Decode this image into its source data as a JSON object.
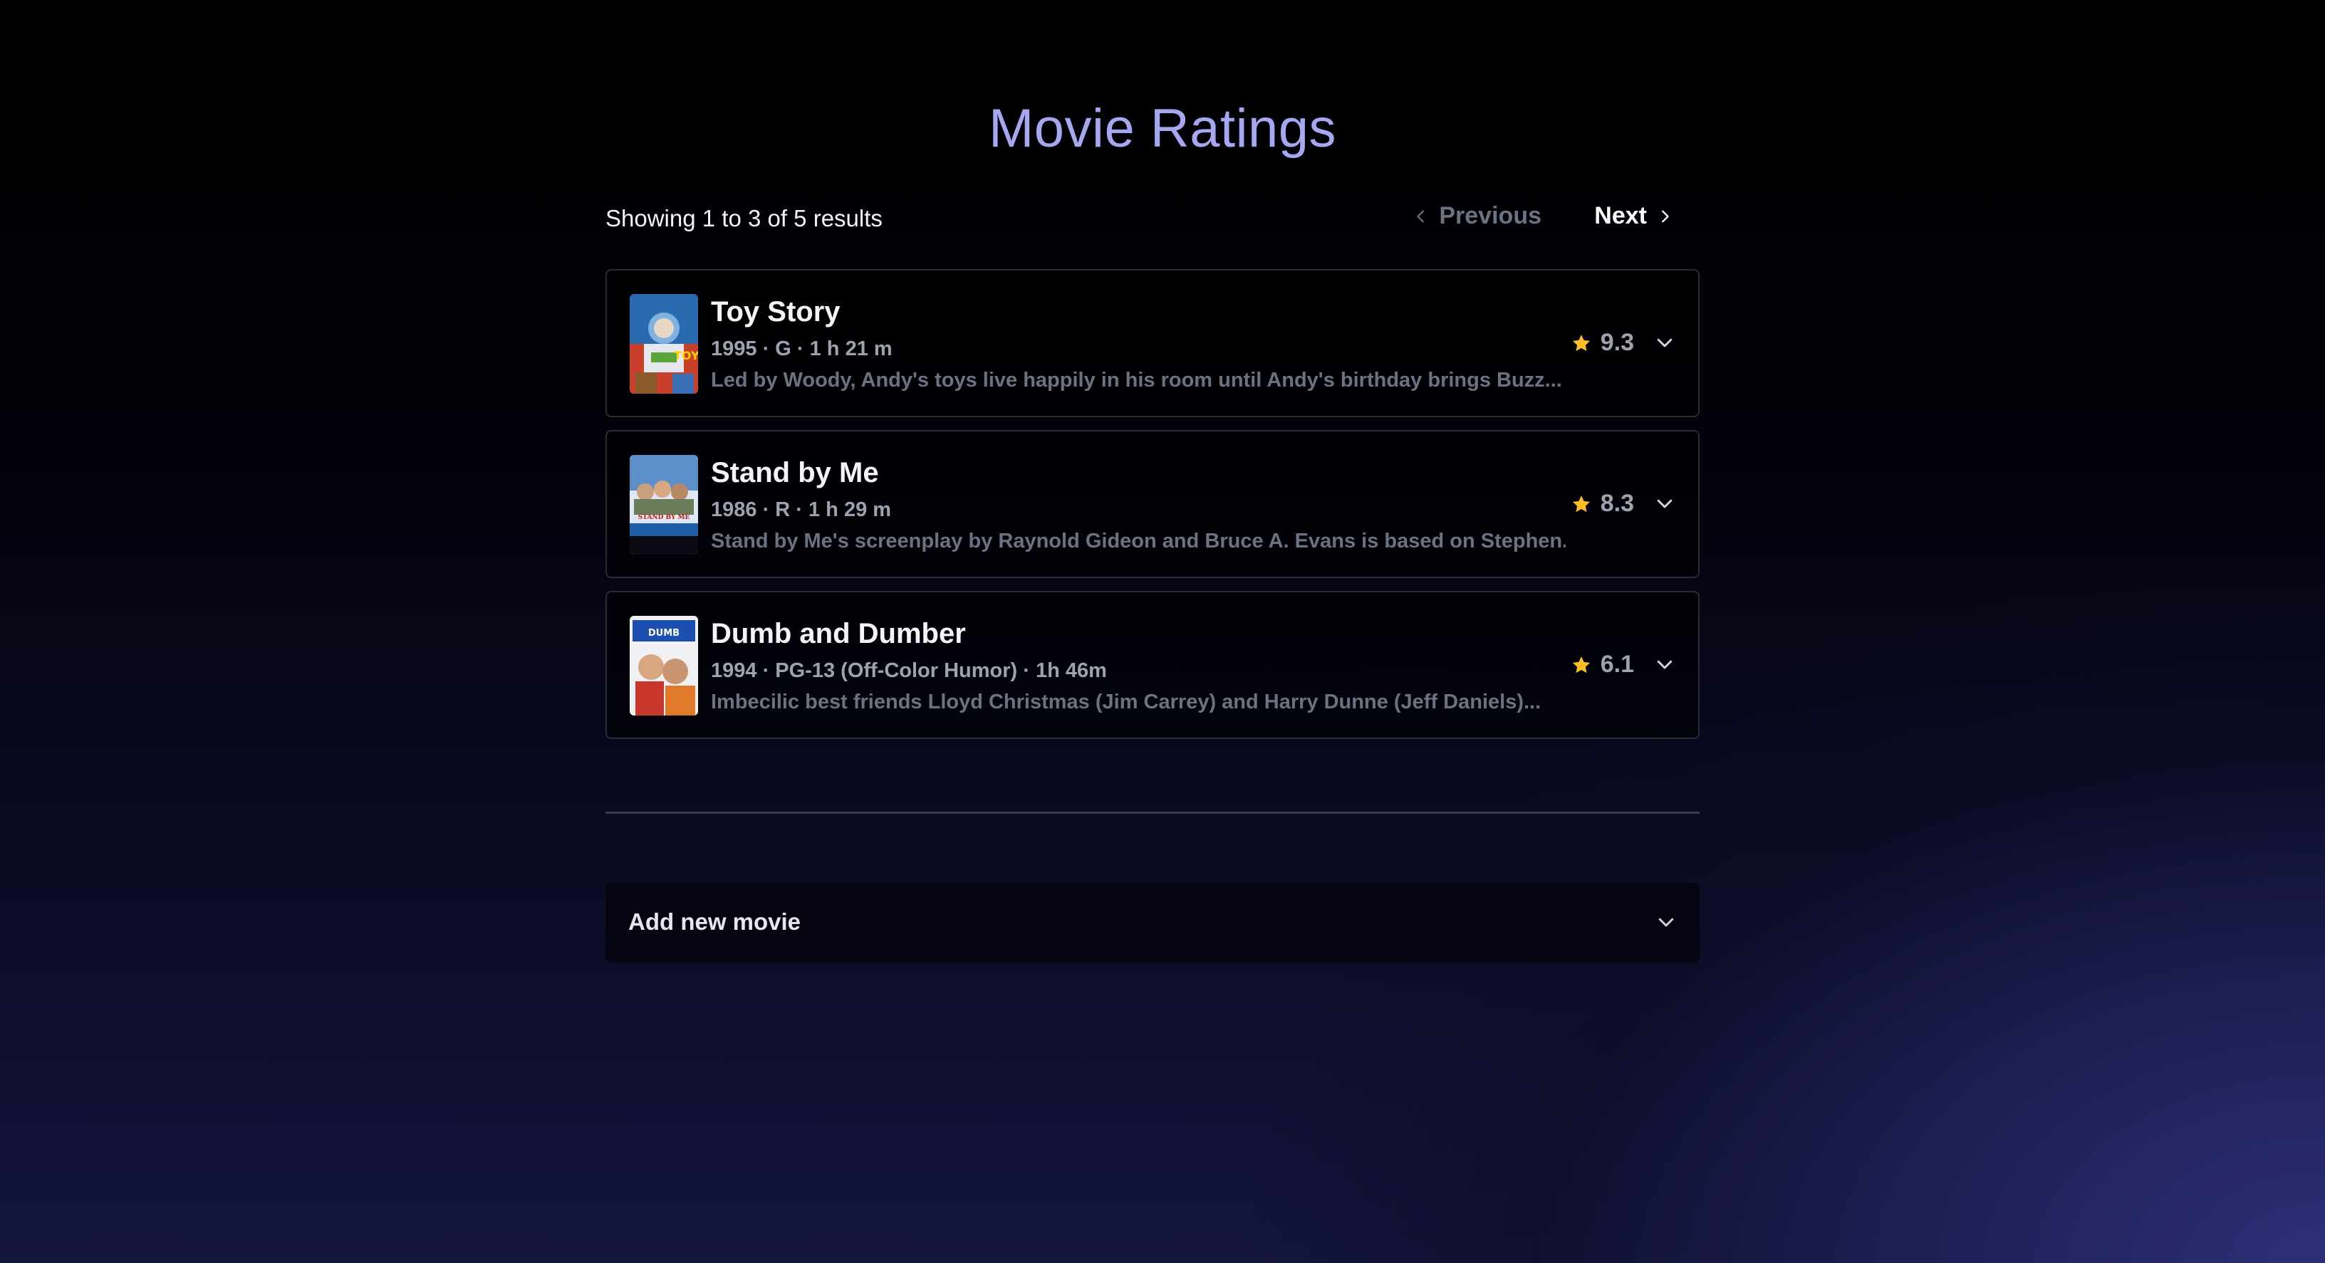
{
  "page": {
    "title": "Movie Ratings"
  },
  "toolbar": {
    "result_count": "Showing 1 to 3 of 5 results",
    "prev_label": "Previous",
    "next_label": "Next",
    "prev_icon": "chevron-left-icon",
    "next_icon": "chevron-right-icon"
  },
  "movies": [
    {
      "title": "Toy Story",
      "meta": "1995 · G · 1 h 21 m",
      "description": "Led by Woody, Andy's toys live happily in his room until Andy's birthday brings Buzz...",
      "rating": "9.3",
      "poster_icon": "poster-image"
    },
    {
      "title": "Stand by Me",
      "meta": "1986 · R · 1 h 29 m",
      "description": "Stand by Me's screenplay by Raynold Gideon and Bruce A. Evans is based on Stephen...",
      "rating": "8.3",
      "poster_icon": "poster-image"
    },
    {
      "title": "Dumb and Dumber",
      "meta": "1994 · PG-13 (Off-Color Humor) · 1h 46m",
      "description": "Imbecilic best friends Lloyd Christmas (Jim Carrey) and Harry Dunne (Jeff Daniels)...",
      "rating": "6.1",
      "poster_icon": "poster-image"
    }
  ],
  "add_movie": {
    "label": "Add new movie",
    "icon": "chevron-down-icon"
  },
  "colors": {
    "accent_title": "#a5a8f0",
    "star": "#fbbf24",
    "background_glow": "#2e2f78"
  }
}
